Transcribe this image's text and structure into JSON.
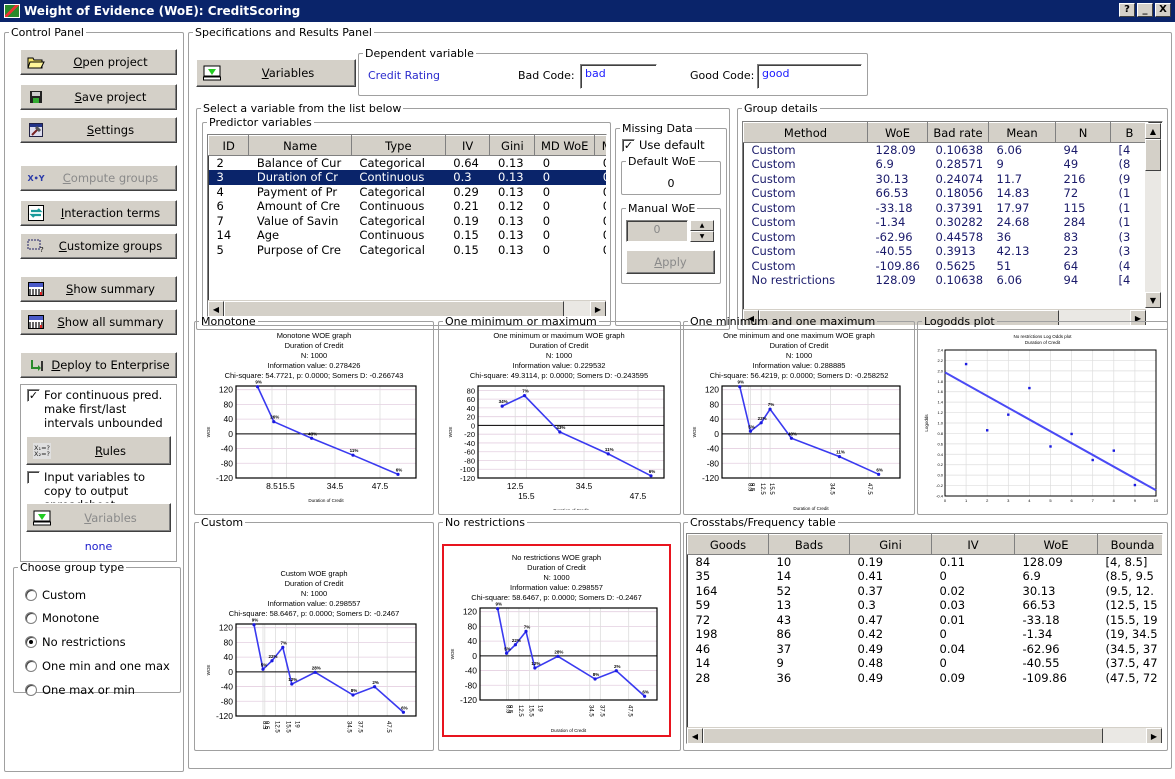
{
  "window": {
    "title": "Weight of Evidence (WoE): CreditScoring",
    "controls": [
      "?",
      "_",
      "X"
    ]
  },
  "control_panel": {
    "title": "Control Panel",
    "buttons": [
      {
        "label": "Open project",
        "icon": "folder-open-icon",
        "enabled": true
      },
      {
        "label": "Save project",
        "icon": "floppy-disk-icon",
        "enabled": true
      },
      {
        "label": "Settings",
        "icon": "settings-hammer-icon",
        "enabled": true
      },
      {
        "label": "Compute groups",
        "icon": "xy-compute-icon",
        "enabled": false
      },
      {
        "label": "Interaction terms",
        "icon": "interaction-arrows-icon",
        "enabled": true
      },
      {
        "label": "Customize groups",
        "icon": "customize-selection-icon",
        "enabled": true
      },
      {
        "label": "Show summary",
        "icon": "summary-table-icon",
        "enabled": true
      },
      {
        "label": "Show all summary",
        "icon": "summary-table-icon",
        "enabled": true
      },
      {
        "label": "Deploy to Enterprise",
        "icon": "deploy-arrow-icon",
        "enabled": true
      }
    ],
    "continuous_checkbox": {
      "label": "For continuous pred. make first/last intervals unbounded",
      "checked": true
    },
    "rules_button": "Rules",
    "rules_icon_text": "X1=?\nX2=?",
    "copy_checkbox": {
      "label": "Input variables to copy to output spreadsheet",
      "checked": false
    },
    "variables_button": "Variables",
    "variables_value": "none",
    "group_type": {
      "title": "Choose group type",
      "options": [
        "Custom",
        "Monotone",
        "No restrictions",
        "One min and one max",
        "One max or min"
      ],
      "selected": "No restrictions"
    }
  },
  "spec_panel": {
    "title": "Specifications and Results Panel",
    "variables_button": "Variables",
    "dependent": {
      "title": "Dependent variable",
      "name": "Credit Rating",
      "bad_code_label": "Bad Code:",
      "bad_code": "bad",
      "good_code_label": "Good Code:",
      "good_code": "good"
    },
    "select_title": "Select a variable from the list below",
    "predictor_title": "Predictor variables",
    "predictor_columns": [
      "ID",
      "Name",
      "Type",
      "IV",
      "Gini",
      "MD WoE",
      "MD"
    ],
    "predictors": [
      [
        "2",
        "Balance of Cur",
        "Categorical",
        "0.64",
        "0.13",
        "0",
        "0"
      ],
      [
        "3",
        "Duration of Cr",
        "Continuous",
        "0.3",
        "0.13",
        "0",
        "0"
      ],
      [
        "4",
        "Payment of Pr",
        "Categorical",
        "0.29",
        "0.13",
        "0",
        "0"
      ],
      [
        "6",
        "Amount of Cre",
        "Continuous",
        "0.21",
        "0.12",
        "0",
        "0"
      ],
      [
        "7",
        "Value of Savin",
        "Categorical",
        "0.19",
        "0.13",
        "0",
        "0"
      ],
      [
        "14",
        "Age",
        "Continuous",
        "0.15",
        "0.13",
        "0",
        "0"
      ],
      [
        "5",
        "Purpose of Cre",
        "Categorical",
        "0.15",
        "0.13",
        "0",
        "0"
      ]
    ],
    "selected_predictor_index": 1,
    "missing": {
      "title": "Missing Data",
      "use_default_label": "Use default",
      "use_default": true,
      "default_title": "Default WoE",
      "default_value": "0",
      "manual_title": "Manual WoE",
      "manual_value": "0",
      "apply": "Apply"
    },
    "group_details": {
      "title": "Group details",
      "columns": [
        "Method",
        "WoE",
        "Bad rate",
        "Mean",
        "N",
        "B"
      ],
      "rows": [
        [
          "Custom",
          "128.09",
          "0.10638",
          "6.06",
          "94",
          "[4"
        ],
        [
          "Custom",
          "6.9",
          "0.28571",
          "9",
          "49",
          "(8"
        ],
        [
          "Custom",
          "30.13",
          "0.24074",
          "11.7",
          "216",
          "(9"
        ],
        [
          "Custom",
          "66.53",
          "0.18056",
          "14.83",
          "72",
          "(1"
        ],
        [
          "Custom",
          "-33.18",
          "0.37391",
          "17.97",
          "115",
          "(1"
        ],
        [
          "Custom",
          "-1.34",
          "0.30282",
          "24.68",
          "284",
          "(1"
        ],
        [
          "Custom",
          "-62.96",
          "0.44578",
          "36",
          "83",
          "(3"
        ],
        [
          "Custom",
          "-40.55",
          "0.3913",
          "42.13",
          "23",
          "(3"
        ],
        [
          "Custom",
          "-109.86",
          "0.5625",
          "51",
          "64",
          "(4"
        ],
        [
          "No restrictions",
          "128.09",
          "0.10638",
          "6.06",
          "94",
          "[4"
        ]
      ]
    },
    "crosstab": {
      "title": "Crosstabs/Frequency table",
      "columns": [
        "Goods",
        "Bads",
        "Gini",
        "IV",
        "WoE",
        "Bounda"
      ],
      "rows": [
        [
          "84",
          "10",
          "0.19",
          "0.11",
          "128.09",
          "[4, 8.5]"
        ],
        [
          "35",
          "14",
          "0.41",
          "0",
          "6.9",
          "(8.5, 9.5"
        ],
        [
          "164",
          "52",
          "0.37",
          "0.02",
          "30.13",
          "(9.5, 12."
        ],
        [
          "59",
          "13",
          "0.3",
          "0.03",
          "66.53",
          "(12.5, 15"
        ],
        [
          "72",
          "43",
          "0.47",
          "0.01",
          "-33.18",
          "(15.5, 19"
        ],
        [
          "198",
          "86",
          "0.42",
          "0",
          "-1.34",
          "(19, 34.5"
        ],
        [
          "46",
          "37",
          "0.49",
          "0.04",
          "-62.96",
          "(34.5, 37"
        ],
        [
          "14",
          "9",
          "0.48",
          "0",
          "-40.55",
          "(37.5, 47"
        ],
        [
          "28",
          "36",
          "0.49",
          "0.09",
          "-109.86",
          "(47.5, 72"
        ]
      ]
    }
  },
  "chart_data": [
    {
      "id": "monotone",
      "panel": "Monotone",
      "type": "line",
      "title": [
        "Monotone WOE graph",
        "Duration of Credit",
        "N: 1000",
        "Information value:  0.278426",
        "Chi-square:  54.7721, p:  0.0000; Somers D: -0.266743"
      ],
      "xlabel": "Duration of Credit",
      "ylabel": "WOE",
      "yticks": [
        120,
        80,
        40,
        0,
        -40,
        -80,
        -120
      ],
      "ylim": [
        -120,
        130
      ],
      "xticks": [
        "8.5",
        "15.5",
        "34.5",
        "47.5"
      ],
      "xtick_pos": [
        0.2,
        0.28,
        0.55,
        0.8
      ],
      "x": [
        0.12,
        0.21,
        0.42,
        0.65,
        0.9
      ],
      "values": [
        128,
        33,
        -12,
        -58,
        -110
      ],
      "labels": [
        "9%",
        "26%",
        "43%",
        "11%",
        "6%"
      ]
    },
    {
      "id": "one-min-or-max",
      "panel": "One minimum or maximum",
      "type": "line",
      "title": [
        "One minimum or maximum WOE graph",
        "Duration of Credit",
        "N: 1000",
        "Information value:  0.229532",
        "Chi-square:  49.3114, p:  0.0000; Somers D: -0.243595"
      ],
      "xlabel": "Duration of Credit",
      "ylabel": "WOE",
      "yticks": [
        80,
        60,
        40,
        20,
        0,
        -20,
        -40,
        -60,
        -80,
        -100,
        -120
      ],
      "ylim": [
        -120,
        90
      ],
      "xticks": [
        "12.5",
        "15.5",
        "34.5",
        "47.5"
      ],
      "xtick_pos": [
        0.2,
        0.26,
        0.57,
        0.86
      ],
      "x": [
        0.13,
        0.25,
        0.44,
        0.7,
        0.93
      ],
      "values": [
        44,
        68,
        -15,
        -65,
        -115
      ],
      "labels": [
        "34%",
        "7%",
        "43%",
        "11%",
        "6%"
      ]
    },
    {
      "id": "one-min-and-max",
      "panel": "One minimum and one maximum",
      "type": "line",
      "title": [
        "One minimum and one maximum WOE graph",
        "Duration of Credit",
        "N: 1000",
        "Information value:  0.288885",
        "Chi-square:  56.4219, p:  0.0000; Somers D: -0.258252"
      ],
      "xlabel": "Duration of Credit",
      "ylabel": "WOE",
      "yticks": [
        120,
        80,
        40,
        0,
        -40,
        -80,
        -120
      ],
      "ylim": [
        -120,
        130
      ],
      "xticks": [
        "8.5",
        "9.5",
        "12.5",
        "15.5",
        "34.5",
        "47.5"
      ],
      "xtick_pos": [
        0.15,
        0.16,
        0.22,
        0.27,
        0.61,
        0.82
      ],
      "x": [
        0.1,
        0.16,
        0.22,
        0.27,
        0.39,
        0.66,
        0.88
      ],
      "values": [
        128,
        7,
        30,
        67,
        -12,
        -62,
        -110
      ],
      "labels": [
        "9%",
        "5%",
        "22%",
        "7%",
        "43%",
        "11%",
        "6%"
      ]
    },
    {
      "id": "custom",
      "panel": "Custom",
      "type": "line",
      "title": [
        "Custom WOE graph",
        "Duration of Credit",
        "N: 1000",
        "Information value:  0.298557",
        "Chi-square:  58.6467, p:  0.0000; Somers D: -0.2467"
      ],
      "xlabel": "Duration of Credit",
      "ylabel": "WOE",
      "yticks": [
        120,
        80,
        40,
        0,
        -40,
        -80,
        -120
      ],
      "ylim": [
        -120,
        130
      ],
      "xticks": [
        "8.5",
        "9.5",
        "12.5",
        "15.5",
        "19",
        "34.5",
        "37.5",
        "47.5"
      ],
      "xtick_pos": [
        0.15,
        0.16,
        0.22,
        0.28,
        0.33,
        0.62,
        0.68,
        0.84
      ],
      "x": [
        0.1,
        0.15,
        0.2,
        0.26,
        0.31,
        0.44,
        0.65,
        0.77,
        0.93
      ],
      "values": [
        128.09,
        6.9,
        30.13,
        66.53,
        -33.18,
        -1.34,
        -62.96,
        -40.55,
        -109.86
      ],
      "labels": [
        "9%",
        "5%",
        "22%",
        "7%",
        "12%",
        "28%",
        "8%",
        "2%",
        "6%"
      ]
    },
    {
      "id": "no-restrictions",
      "panel": "No restrictions",
      "type": "line",
      "title": [
        "No restrictions WOE graph",
        "Duration of Credit",
        "N: 1000",
        "Information value:  0.298557",
        "Chi-square:  58.6467, p:  0.0000; Somers D: -0.2467"
      ],
      "xlabel": "Duration of Credit",
      "ylabel": "WOE",
      "yticks": [
        120,
        80,
        40,
        0,
        -40,
        -80,
        -120
      ],
      "ylim": [
        -120,
        130
      ],
      "xticks": [
        "8.5",
        "9.5",
        "12.5",
        "15.5",
        "19",
        "34.5",
        "37.5",
        "47.5"
      ],
      "xtick_pos": [
        0.15,
        0.16,
        0.22,
        0.28,
        0.33,
        0.62,
        0.68,
        0.84
      ],
      "x": [
        0.1,
        0.15,
        0.2,
        0.26,
        0.31,
        0.44,
        0.65,
        0.77,
        0.93
      ],
      "values": [
        128.09,
        6.9,
        30.13,
        66.53,
        -33.18,
        -1.34,
        -62.96,
        -40.55,
        -109.86
      ],
      "labels": [
        "9%",
        "5%",
        "22%",
        "7%",
        "12%",
        "28%",
        "8%",
        "2%",
        "6%"
      ],
      "highlighted": true
    },
    {
      "id": "logodds",
      "panel": "Logodds plot",
      "type": "scatter",
      "title": [
        "No restrictions Log Odds plot",
        "Duration of Credit"
      ],
      "xlabel": "",
      "ylabel": "Logodds",
      "xlim": [
        0,
        10
      ],
      "ylim": [
        -0.4,
        2.4
      ],
      "xticks": [
        0,
        1,
        2,
        3,
        4,
        5,
        6,
        7,
        8,
        9,
        10
      ],
      "yticks": [
        2.4,
        2.2,
        2.0,
        1.8,
        1.6,
        1.4,
        1.2,
        1.0,
        0.8,
        0.6,
        0.4,
        0.2,
        0.0,
        -0.2,
        -0.4
      ],
      "x": [
        1,
        2,
        3,
        4,
        5,
        6,
        7,
        8,
        9
      ],
      "values": [
        2.13,
        0.86,
        1.16,
        1.67,
        0.55,
        0.79,
        0.29,
        0.47,
        -0.19
      ],
      "fit_line": {
        "x": [
          0,
          10
        ],
        "y": [
          1.97,
          -0.29
        ]
      }
    }
  ]
}
